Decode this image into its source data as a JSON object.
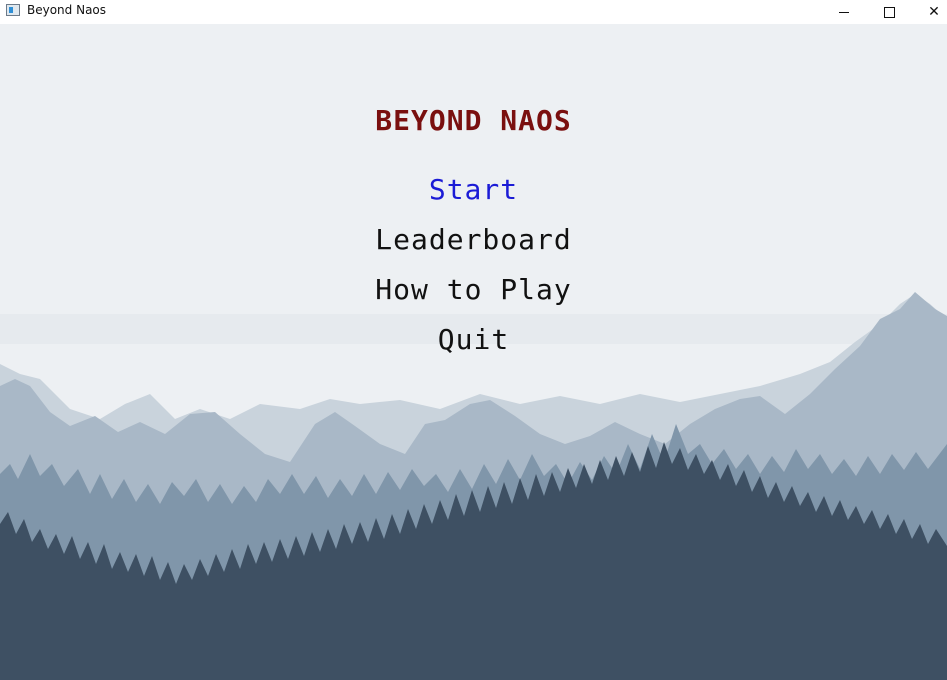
{
  "window": {
    "title": "Beyond Naos",
    "controls": [
      "minimize",
      "maximize",
      "close"
    ]
  },
  "game": {
    "title": "BEYOND NAOS",
    "menu_items": [
      {
        "label": "Start",
        "selected": true
      },
      {
        "label": "Leaderboard",
        "selected": false
      },
      {
        "label": "How to Play",
        "selected": false
      },
      {
        "label": "Quit",
        "selected": false
      }
    ]
  },
  "colors": {
    "sky": "#edf0f3",
    "title_text": "#7a0f0f",
    "selected_text": "#1b1bd6",
    "menu_text": "#111111",
    "far_mountains": "#c5d0da",
    "mid_mountains": "#a7b7c6",
    "far_forest": "#7f95a9",
    "near_forest": "#3e5063"
  }
}
